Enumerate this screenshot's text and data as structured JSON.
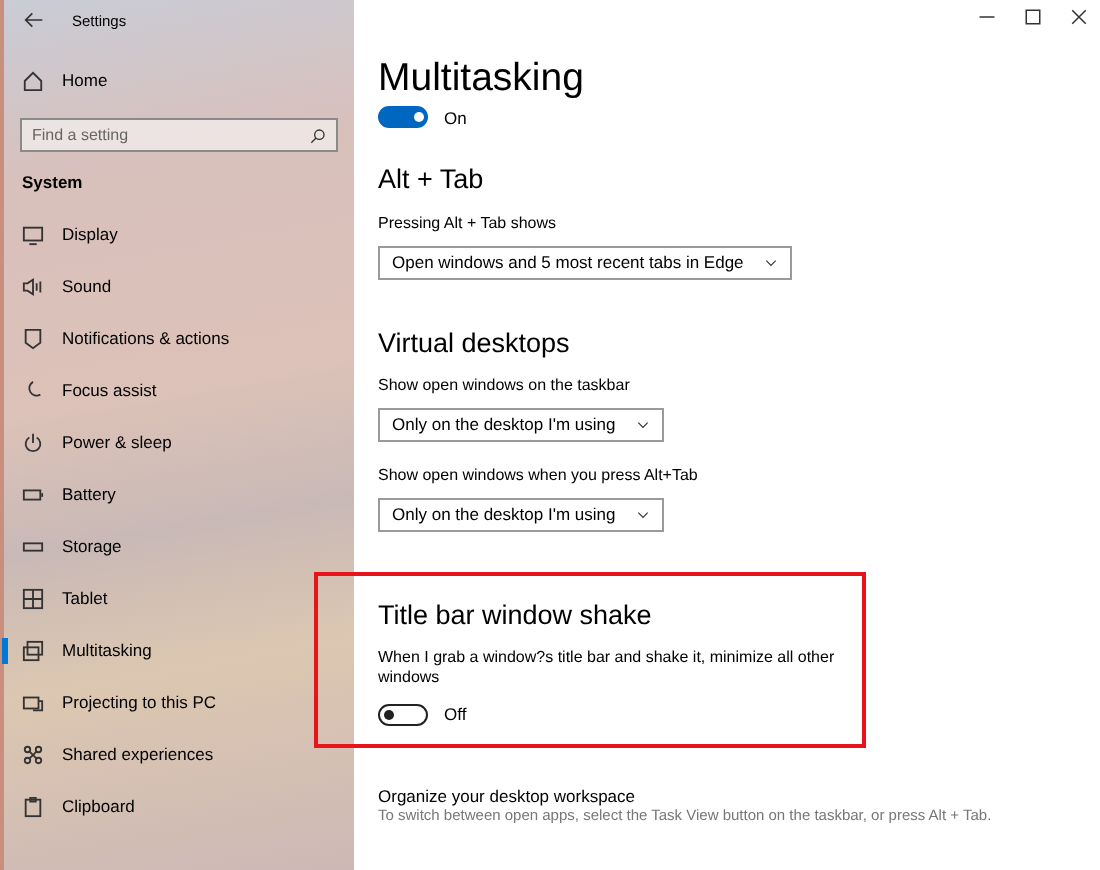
{
  "window": {
    "title": "Settings"
  },
  "sidebar": {
    "home": "Home",
    "search": {
      "placeholder": "Find a setting"
    },
    "section": "System",
    "items": [
      {
        "label": "Display",
        "selected": false
      },
      {
        "label": "Sound",
        "selected": false
      },
      {
        "label": "Notifications & actions",
        "selected": false
      },
      {
        "label": "Focus assist",
        "selected": false
      },
      {
        "label": "Power & sleep",
        "selected": false
      },
      {
        "label": "Battery",
        "selected": false
      },
      {
        "label": "Storage",
        "selected": false
      },
      {
        "label": "Tablet",
        "selected": false
      },
      {
        "label": "Multitasking",
        "selected": true
      },
      {
        "label": "Projecting to this PC",
        "selected": false
      },
      {
        "label": "Shared experiences",
        "selected": false
      },
      {
        "label": "Clipboard",
        "selected": false
      }
    ]
  },
  "page": {
    "title": "Multitasking",
    "toggle": {
      "on": true,
      "state_label": "On"
    },
    "sections": [
      {
        "heading": "Alt + Tab",
        "highlighted": false,
        "settings": [
          {
            "kind": "dropdown",
            "label": "Pressing Alt + Tab shows",
            "value": "Open windows and 5 most recent tabs in Edge"
          }
        ]
      },
      {
        "heading": "Virtual desktops",
        "highlighted": false,
        "settings": [
          {
            "kind": "dropdown",
            "label": "Show open windows on the taskbar",
            "value": "Only on the desktop I'm using"
          },
          {
            "kind": "dropdown",
            "label": "Show open windows when you press Alt+Tab",
            "value": "Only on the desktop I'm using"
          }
        ]
      },
      {
        "heading": "Title bar window shake",
        "highlighted": true,
        "settings": [
          {
            "kind": "toggle",
            "label": "When I grab a window?s title bar and shake it, minimize all other windows",
            "on": false,
            "state_label": "Off"
          }
        ]
      }
    ],
    "footer": {
      "heading": "Organize your desktop workspace",
      "text": "To switch between open apps, select the Task View button on the taskbar, or press Alt + Tab."
    }
  }
}
